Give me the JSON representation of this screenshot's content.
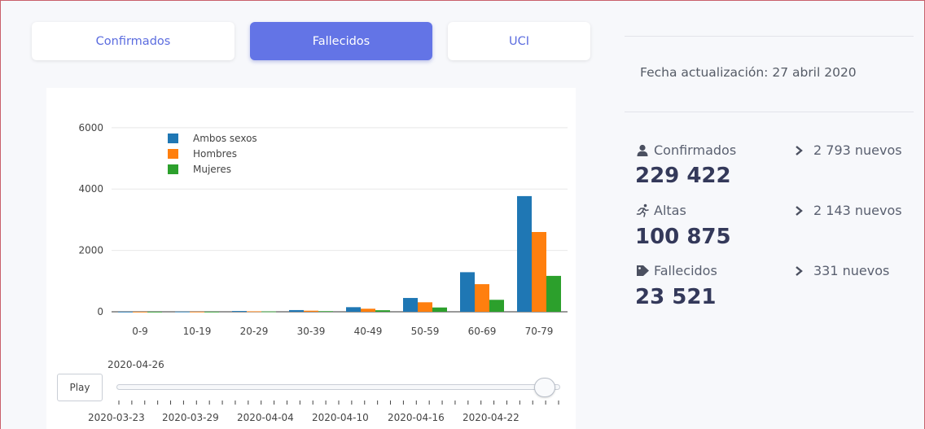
{
  "tabs": [
    {
      "label": "Confirmados",
      "active": false
    },
    {
      "label": "Fallecidos",
      "active": true
    },
    {
      "label": "UCI",
      "active": false
    }
  ],
  "chart_data": {
    "type": "bar",
    "categories": [
      "0-9",
      "10-19",
      "20-29",
      "30-39",
      "40-49",
      "50-59",
      "60-69",
      "70-79"
    ],
    "series": [
      {
        "name": "Ambos sexos",
        "color": "#1f77b4",
        "values": [
          2,
          5,
          25,
          55,
          150,
          450,
          1290,
          3770
        ]
      },
      {
        "name": "Hombres",
        "color": "#ff7f0e",
        "values": [
          1,
          3,
          15,
          35,
          100,
          310,
          900,
          2600
        ]
      },
      {
        "name": "Mujeres",
        "color": "#2ca02c",
        "values": [
          1,
          2,
          10,
          20,
          50,
          140,
          390,
          1170
        ]
      }
    ],
    "yticks": [
      "0",
      "2000",
      "4000",
      "6000"
    ],
    "ylim": [
      0,
      6500
    ],
    "grid": true,
    "legend_position": "top-left"
  },
  "slider": {
    "play_label": "Play",
    "current_date": "2020-04-26",
    "tick_labels": [
      "2020-03-23",
      "2020-03-29",
      "2020-04-04",
      "2020-04-10",
      "2020-04-16",
      "2020-04-22"
    ],
    "position_fraction": 1.0
  },
  "summary": {
    "update_text": "Fecha actualización: 27 abril 2020",
    "items": [
      {
        "icon": "user-icon",
        "label": "Confirmados",
        "value": "229 422",
        "new": "2 793 nuevos"
      },
      {
        "icon": "running-icon",
        "label": "Altas",
        "value": "100 875",
        "new": "2 143 nuevos"
      },
      {
        "icon": "tag-icon",
        "label": "Fallecidos",
        "value": "23 521",
        "new": "331 nuevos"
      }
    ]
  },
  "colors": {
    "accent": "#6374e6",
    "value_text": "#34395a",
    "frame_border": "#c9606b"
  }
}
